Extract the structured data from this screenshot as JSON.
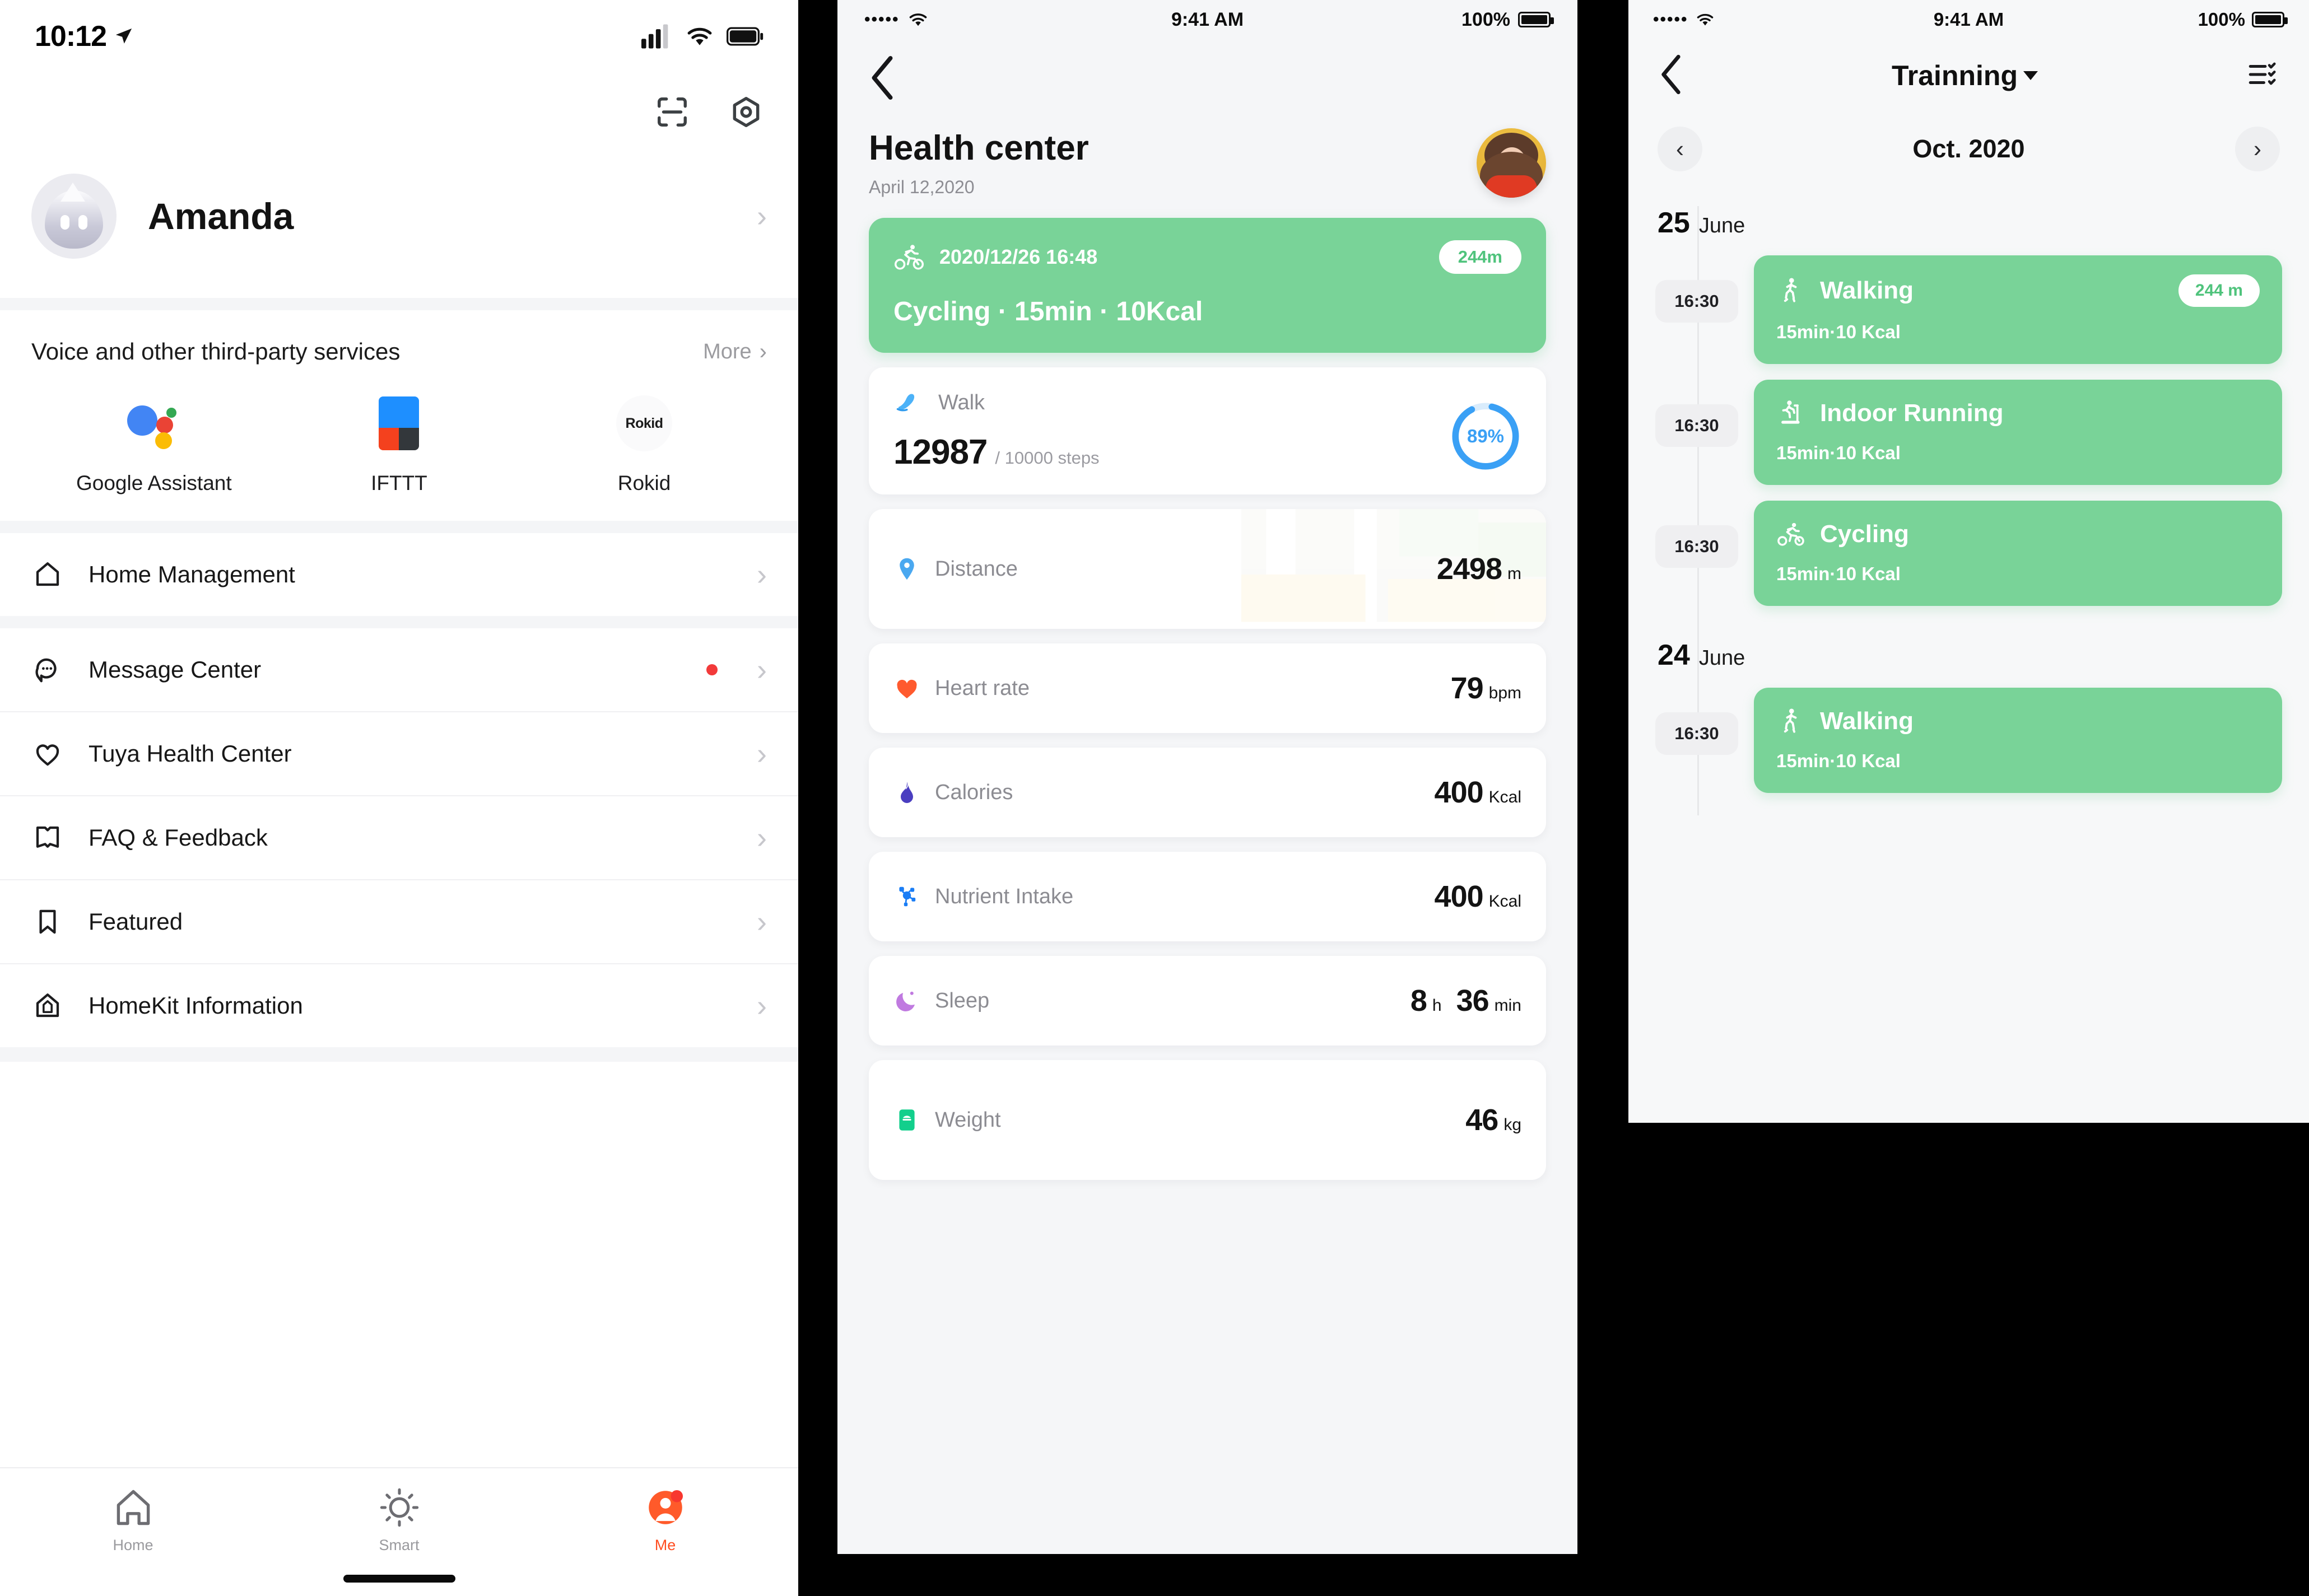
{
  "panel1": {
    "status": {
      "time": "10:12",
      "location_icon": "location-arrow-icon"
    },
    "toolbar": {
      "scan_icon": "scan-icon",
      "settings_icon": "settings-hexagon-icon"
    },
    "profile": {
      "name": "Amanda"
    },
    "services": {
      "title": "Voice and other third-party services",
      "more_label": "More",
      "items": [
        {
          "label": "Google Assistant",
          "icon": "google-assistant-icon"
        },
        {
          "label": "IFTTT",
          "icon": "ifttt-icon"
        },
        {
          "label": "Rokid",
          "icon": "rokid-icon",
          "badge_text": "Rokid"
        }
      ]
    },
    "menu": [
      {
        "label": "Home Management",
        "icon": "home-outline-icon",
        "badge": false
      },
      {
        "label": "Message Center",
        "icon": "message-bubble-icon",
        "badge": true
      },
      {
        "label": "Tuya Health Center",
        "icon": "heart-outline-icon",
        "badge": false
      },
      {
        "label": "FAQ & Feedback",
        "icon": "book-open-icon",
        "badge": false
      },
      {
        "label": "Featured",
        "icon": "bookmark-icon",
        "badge": false
      },
      {
        "label": "HomeKit Information",
        "icon": "homekit-house-icon",
        "badge": false
      }
    ],
    "tabs": [
      {
        "label": "Home",
        "icon": "home-icon",
        "active": false
      },
      {
        "label": "Smart",
        "icon": "sun-icon",
        "active": false
      },
      {
        "label": "Me",
        "icon": "person-icon",
        "active": true
      }
    ],
    "accent_color": "#ff4d20"
  },
  "panel2": {
    "status": {
      "signal": "•••••",
      "wifi_icon": "wifi-icon",
      "time": "9:41 AM",
      "battery_pct": "100%"
    },
    "back_icon": "chevron-left-icon",
    "title": "Health center",
    "date": "April 12,2020",
    "avatar": "user-photo-avatar",
    "cycle_card": {
      "icon": "cycling-icon",
      "timestamp": "2020/12/26 16:48",
      "distance_pill": "244m",
      "summary": "Cycling · 15min · 10Kcal",
      "bg_color": "#79d398"
    },
    "walk_card": {
      "icon": "walk-shoe-icon",
      "title": "Walk",
      "steps": "12987",
      "goal": "/ 10000 steps",
      "ring_pct": "89%",
      "ring_value": 89,
      "ring_color": "#3aa0f5"
    },
    "metrics": [
      {
        "label": "Distance",
        "value": "2498",
        "unit": "m",
        "icon": "map-pin-icon",
        "icon_color": "#4aa8f0",
        "has_map_bg": true
      },
      {
        "label": "Heart rate",
        "value": "79",
        "unit": "bpm",
        "icon": "heart-filled-icon",
        "icon_color": "#ff5a2e",
        "has_map_bg": false
      },
      {
        "label": "Calories",
        "value": "400",
        "unit": "Kcal",
        "icon": "flame-icon",
        "icon_color": "#4a3ec0",
        "has_map_bg": false
      },
      {
        "label": "Nutrient Intake",
        "value": "400",
        "unit": "Kcal",
        "icon": "nutrient-molecule-icon",
        "icon_color": "#1a7df5",
        "has_map_bg": false
      },
      {
        "label": "Sleep",
        "value": "8",
        "unit": "h",
        "value2": "36",
        "unit2": "min",
        "icon": "moon-icon",
        "icon_color": "#c07ae0",
        "has_map_bg": false
      },
      {
        "label": "Weight",
        "value": "46",
        "unit": "kg",
        "icon": "scale-icon",
        "icon_color": "#12cf8c",
        "has_map_bg": false
      }
    ]
  },
  "panel3": {
    "status": {
      "signal": "•••••",
      "wifi_icon": "wifi-icon",
      "time": "9:41 AM",
      "battery_pct": "100%"
    },
    "back_icon": "chevron-left-icon",
    "title": "Trainning",
    "menu_icon": "checklist-icon",
    "month": {
      "prev_icon": "chevron-left-icon",
      "label": "Oct. 2020",
      "next_icon": "chevron-right-icon"
    },
    "days": [
      {
        "day": "25",
        "month": "June",
        "entries": [
          {
            "time": "16:30",
            "name": "Walking",
            "sub": "15min·10 Kcal",
            "pill": "244 m",
            "icon": "walking-person-icon"
          },
          {
            "time": "16:30",
            "name": "Indoor Running",
            "sub": "15min·10 Kcal",
            "pill": "",
            "icon": "treadmill-icon"
          },
          {
            "time": "16:30",
            "name": "Cycling",
            "sub": "15min·10 Kcal",
            "pill": "",
            "icon": "cycling-icon"
          }
        ]
      },
      {
        "day": "24",
        "month": "June",
        "entries": [
          {
            "time": "16:30",
            "name": "Walking",
            "sub": "15min·10 Kcal",
            "pill": "",
            "icon": "walking-person-icon"
          }
        ]
      }
    ],
    "card_color": "#79d398"
  }
}
